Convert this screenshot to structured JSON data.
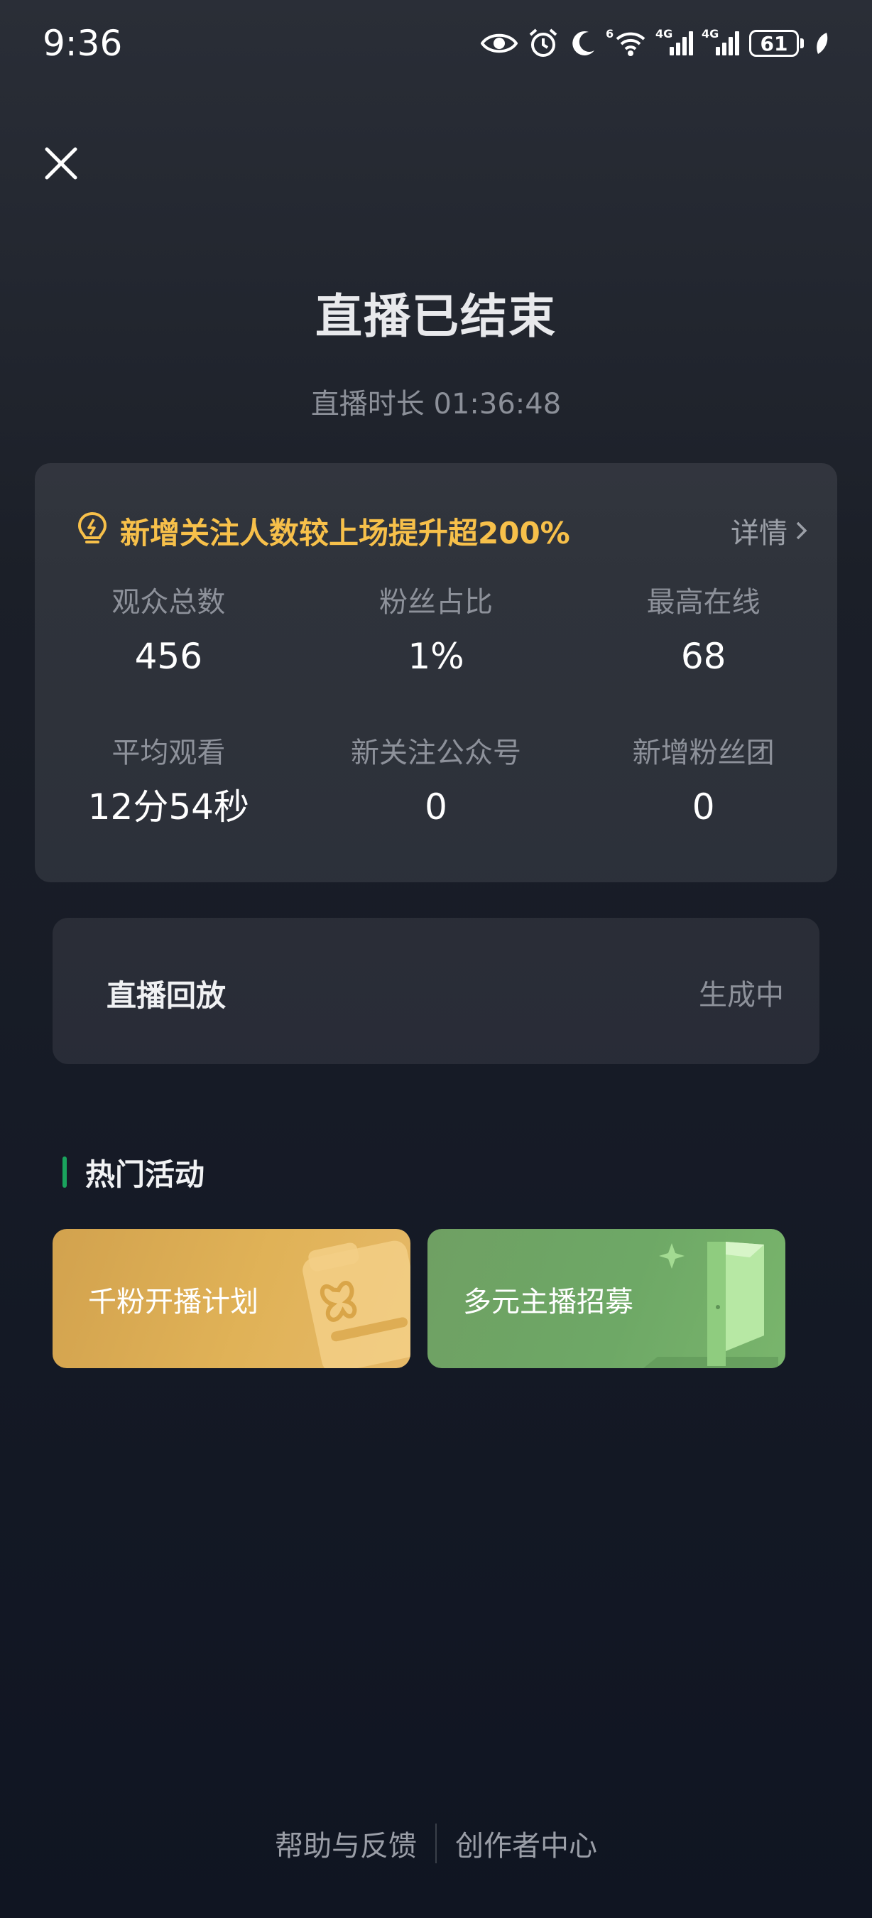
{
  "status_bar": {
    "time": "9:36",
    "net1_label": "6",
    "net2_label": "4G",
    "net3_label": "4G",
    "battery": "61"
  },
  "header": {
    "title": "直播已结束",
    "duration": "直播时长 01:36:48"
  },
  "stats": {
    "promo_text": "新增关注人数较上场提升超200%",
    "detail_label": "详情",
    "items": [
      {
        "label": "观众总数",
        "value": "456"
      },
      {
        "label": "粉丝占比",
        "value": "1%"
      },
      {
        "label": "最高在线",
        "value": "68"
      },
      {
        "label": "平均观看",
        "value": "12分54秒"
      },
      {
        "label": "新关注公众号",
        "value": "0"
      },
      {
        "label": "新增粉丝团",
        "value": "0"
      }
    ]
  },
  "replay": {
    "label": "直播回放",
    "status": "生成中"
  },
  "hot": {
    "title": "热门活动",
    "activities": [
      {
        "label": "千粉开播计划"
      },
      {
        "label": "多元主播招募"
      }
    ]
  },
  "footer": {
    "help": "帮助与反馈",
    "creator": "创作者中心"
  },
  "colors": {
    "promo": "#f7c04a",
    "accent_bar": "#1aa35d",
    "activity1": "#dcae57",
    "activity2": "#6ea866"
  }
}
